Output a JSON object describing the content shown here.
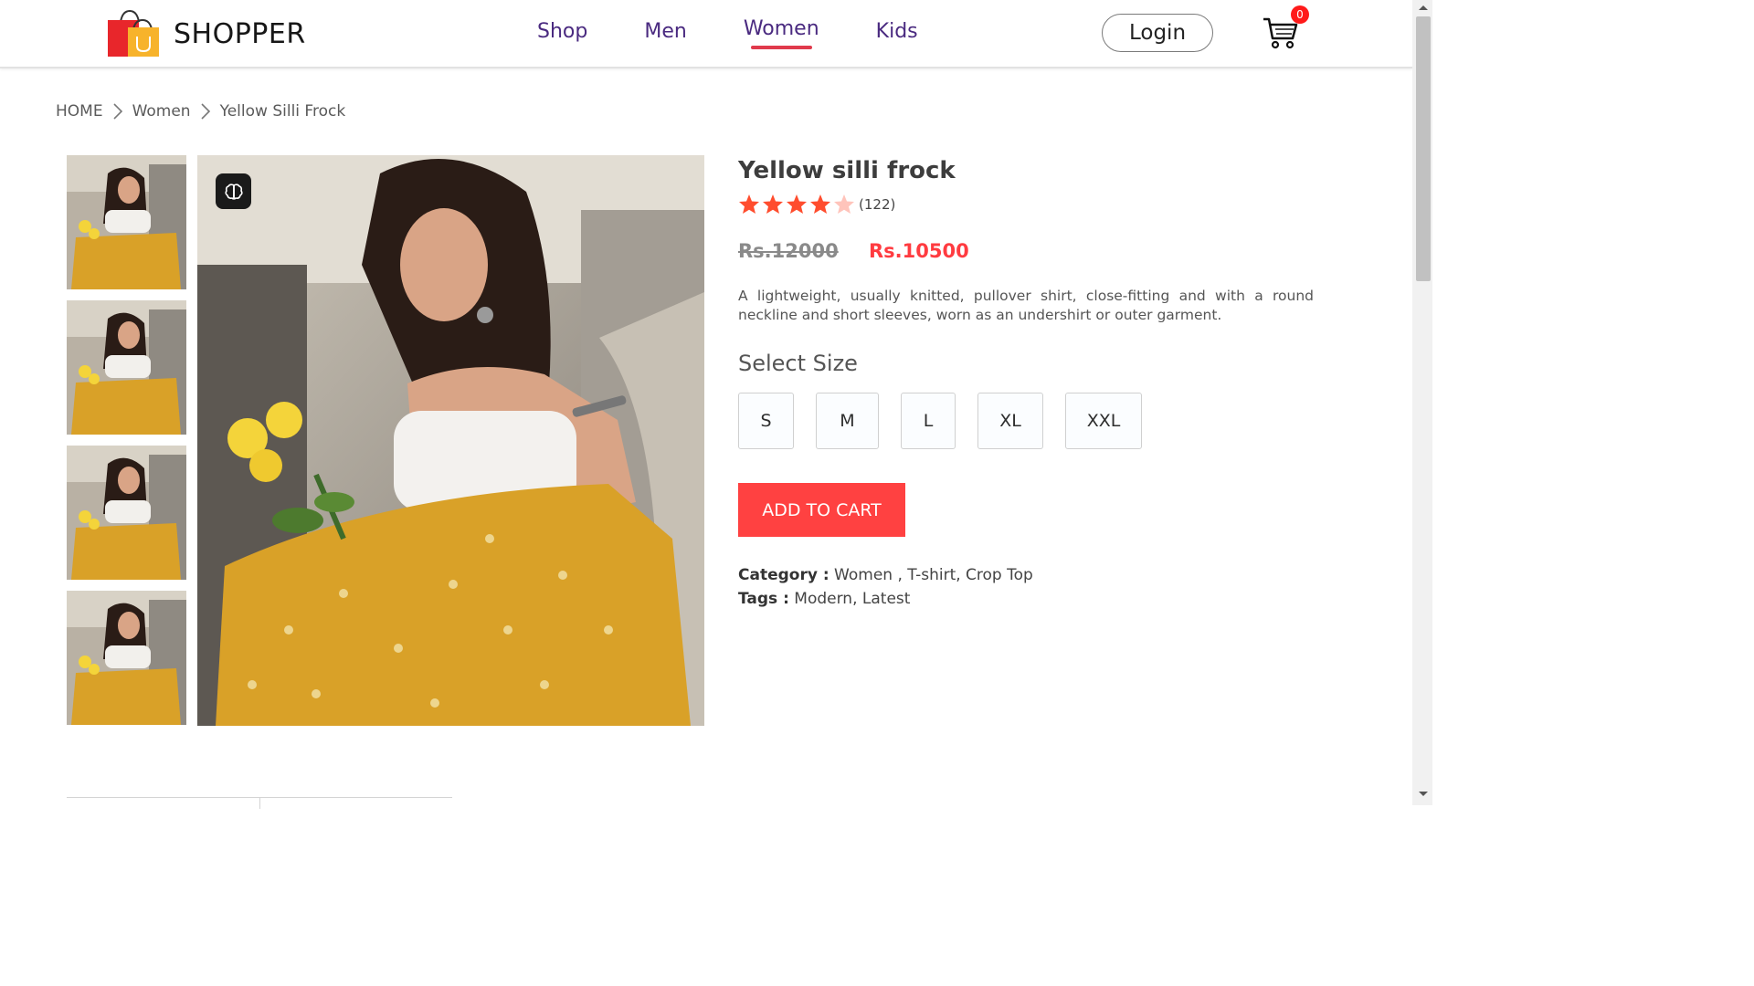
{
  "brand": {
    "name": "SHOPPER",
    "logo_icon": "shopping-bag-icon"
  },
  "nav": {
    "items": [
      {
        "label": "Shop"
      },
      {
        "label": "Men"
      },
      {
        "label": "Women",
        "active": true
      },
      {
        "label": "Kids"
      }
    ],
    "login_label": "Login",
    "cart_icon": "cart-icon",
    "cart_count": "0"
  },
  "breadcrumb": {
    "items": [
      "HOME",
      "Women",
      "Yellow Silli Frock"
    ],
    "separator_icon": "chevron-right-icon"
  },
  "product": {
    "title": "Yellow silli frock",
    "rating": {
      "stars": 4,
      "max": 5,
      "count": "(122)"
    },
    "old_price": "Rs.12000",
    "new_price": "Rs.10500",
    "description": "A lightweight, usually knitted, pullover shirt, close-fitting and with a round neckline and short sleeves, worn as an undershirt or outer garment.",
    "size_title": "Select Size",
    "sizes": [
      "S",
      "M",
      "L",
      "XL",
      "XXL"
    ],
    "add_to_cart_label": "ADD TO CART",
    "category_label": "Category :",
    "category_value": "Women , T-shirt, Crop Top",
    "tags_label": "Tags :",
    "tags_value": "Modern, Latest"
  },
  "colors": {
    "accent": "#ff4141",
    "nav_text": "#4a2a80",
    "underline": "#e03a4c",
    "star": "#ff4d2e"
  }
}
